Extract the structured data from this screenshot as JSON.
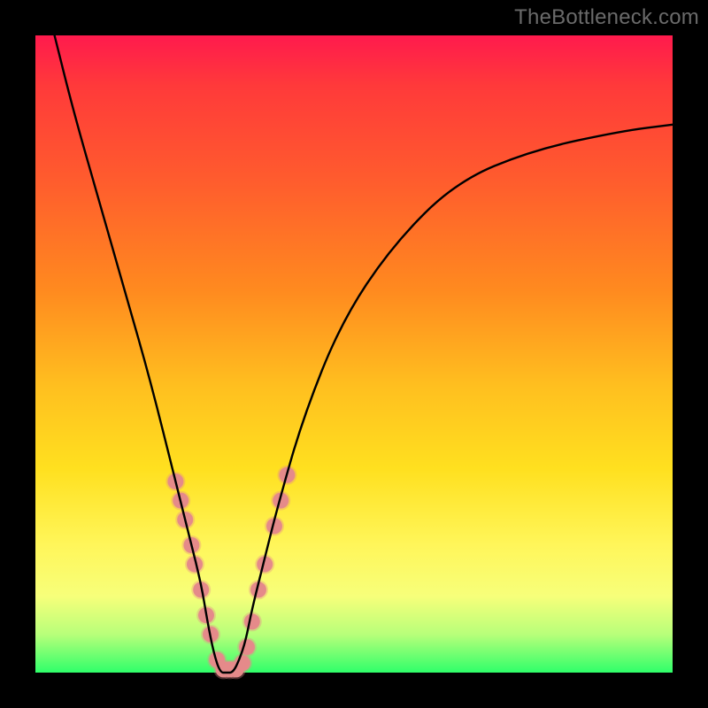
{
  "watermark": "TheBottleneck.com",
  "chart_data": {
    "type": "line",
    "title": "",
    "xlabel": "",
    "ylabel": "",
    "xlim": [
      0,
      100
    ],
    "ylim": [
      0,
      100
    ],
    "series": [
      {
        "name": "bottleneck-curve",
        "x": [
          3,
          6,
          10,
          14,
          18,
          22,
          24,
          26,
          27,
          28,
          29,
          30,
          31,
          32,
          33,
          34,
          36,
          38,
          42,
          48,
          56,
          66,
          78,
          92,
          100
        ],
        "y": [
          100,
          88,
          74,
          60,
          46,
          30,
          22,
          14,
          8,
          3,
          0,
          0,
          0,
          2,
          5,
          10,
          18,
          26,
          40,
          55,
          67,
          77,
          82,
          85,
          86
        ]
      }
    ],
    "markers": {
      "name": "highlighted-points",
      "color": "#e58a8a",
      "radius_primary": 9,
      "radius_halo": 11,
      "points": [
        {
          "x": 22.0,
          "y": 30
        },
        {
          "x": 22.8,
          "y": 27
        },
        {
          "x": 23.5,
          "y": 24
        },
        {
          "x": 24.5,
          "y": 20
        },
        {
          "x": 25.0,
          "y": 17
        },
        {
          "x": 26.0,
          "y": 13
        },
        {
          "x": 26.8,
          "y": 9
        },
        {
          "x": 27.5,
          "y": 6
        },
        {
          "x": 28.5,
          "y": 2
        },
        {
          "x": 29.5,
          "y": 0.5
        },
        {
          "x": 30.5,
          "y": 0.5
        },
        {
          "x": 31.5,
          "y": 0.5
        },
        {
          "x": 32.5,
          "y": 1.5
        },
        {
          "x": 33.2,
          "y": 4
        },
        {
          "x": 34.0,
          "y": 8
        },
        {
          "x": 35.0,
          "y": 13
        },
        {
          "x": 36.0,
          "y": 17
        },
        {
          "x": 37.5,
          "y": 23
        },
        {
          "x": 38.5,
          "y": 27
        },
        {
          "x": 39.5,
          "y": 31
        }
      ]
    }
  }
}
